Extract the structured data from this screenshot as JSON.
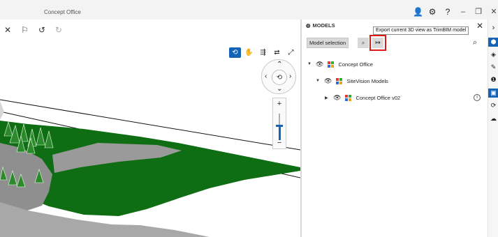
{
  "window": {
    "title": "Concept Office",
    "controls": {
      "user": "👤",
      "settings": "⚙",
      "help": "?",
      "minimize": "–",
      "restore": "❐",
      "close": "✕"
    }
  },
  "toolbar": {
    "close_x": "✕",
    "pin": "⚐",
    "undo": "↺",
    "redo": "↻"
  },
  "view_tools": {
    "orbit": "⟲",
    "pan": "✋",
    "walk": "⇶",
    "swap": "⇄",
    "expand": "⤢"
  },
  "nav_wheel": {
    "up": "⌃",
    "down": "⌄",
    "left": "‹",
    "right": "›",
    "center": "⟲"
  },
  "zoom": {
    "plus": "+",
    "minus": "−"
  },
  "panel": {
    "title": "MODELS",
    "title_icon": "◍",
    "close": "✕",
    "model_selection": "Model selection",
    "find_icon": "⌕",
    "export_icon": "↦",
    "search_icon": "⌕",
    "tooltip": "Export current 3D view as TrimBIM model",
    "tree": [
      {
        "label": "Concept Office",
        "arrow": "▼",
        "eye": "👁"
      },
      {
        "label": "SiteVision Models",
        "arrow": "▼",
        "eye": "👁"
      },
      {
        "label": "Concept Office v02",
        "arrow": "▶",
        "eye": "👁",
        "info": "i"
      }
    ]
  },
  "rail": {
    "collapse": "›",
    "models": "⬢",
    "layers": "◈",
    "measure": "✎",
    "clash": "❶",
    "views": "▣",
    "history": "⟳",
    "cloud": "☁"
  },
  "colors": {
    "accent": "#1463b5",
    "highlight": "#e01818",
    "grass": "#0f6e14",
    "road": "#8f8f8f"
  }
}
